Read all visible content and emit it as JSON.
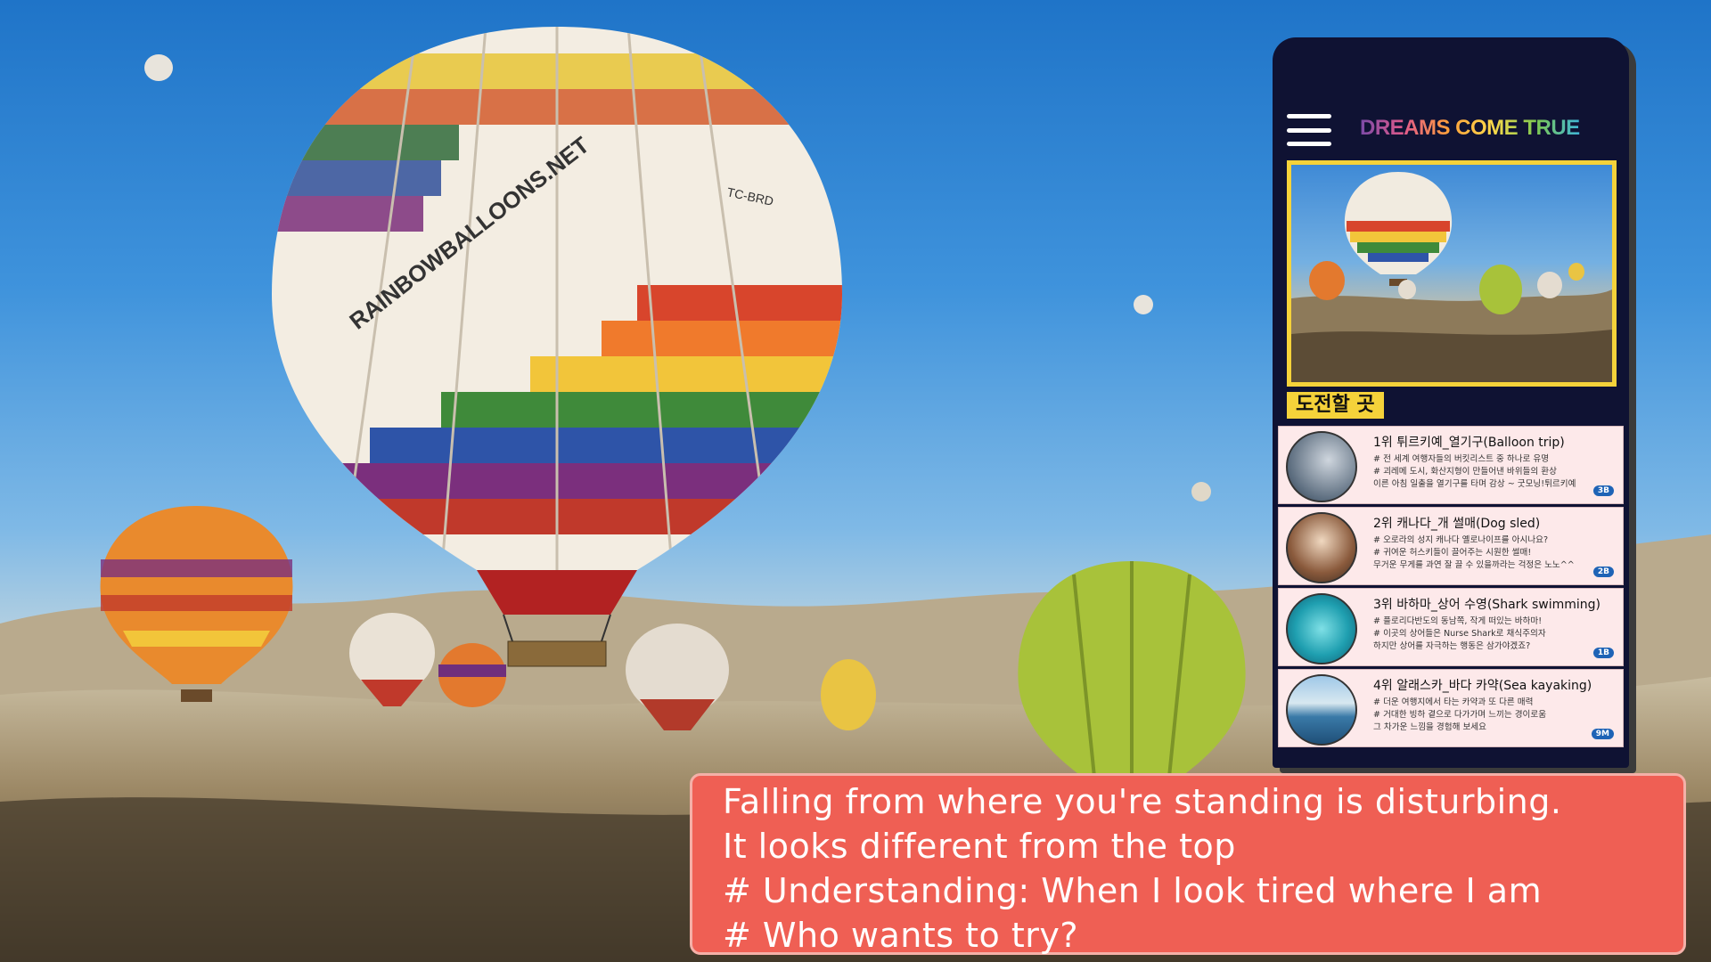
{
  "app": {
    "brand": "DREAMS COME TRUE",
    "menu_icon": "hamburger-menu-icon"
  },
  "hero": {
    "balloon_text": "RAINBOWBALLOONS.NET",
    "balloon_reg": "TC-BRD"
  },
  "section": {
    "title": "도전할 곳"
  },
  "items": [
    {
      "title": "1위 튀르키예_열기구(Balloon trip)",
      "lines": [
        "# 전 세계 여행자들의 버킷리스트 중 하나로 유명",
        "# 괴레메 도시, 화산지형이 만들어낸 바위들의 환상",
        "이른 아침 일출을 열기구를 타며 감상 ~ 굿모닝!튀르키예"
      ],
      "badge": "3B"
    },
    {
      "title": "2위 캐나다_개 썰매(Dog sled)",
      "lines": [
        "# 오로라의 성지 캐나다 옐로나이프를 아시나요?",
        "# 귀여운 허스키들이 끌어주는 시원한 썰매!",
        "무거운 무게를 과연 잘 끌 수 있을까라는 걱정은 노노^^"
      ],
      "badge": "2B"
    },
    {
      "title": "3위 바하마_상어 수영(Shark swimming)",
      "lines": [
        "# 플로리다반도의 동남쪽, 작게 떠있는 바하마!",
        "# 이곳의 상어들은 Nurse Shark로 채식주의자",
        "하지만 상어를 자극하는 행동은 삼가야겠죠?"
      ],
      "badge": "1B"
    },
    {
      "title": "4위 알래스카_바다 카약(Sea kayaking)",
      "lines": [
        "# 더운 여행지에서 타는 카약과 또 다른 매력",
        "# 거대한 빙하 곁으로 다가가며 느끼는 경이로움",
        "그 차가운 느낌을 경험해 보세요"
      ],
      "badge": "9M"
    }
  ],
  "caption": {
    "line1": "Falling from where you're standing is disturbing.",
    "line2": "It looks different from the top",
    "line3": "# Understanding: When I look tired where I am",
    "line4": "# Who wants to try?"
  },
  "colors": {
    "phone_bg": "#0f1233",
    "accent_yellow": "#f5d23a",
    "item_bg": "#fde9ea",
    "caption_bg": "#ef5f54",
    "badge_blue": "#1e63b6"
  }
}
